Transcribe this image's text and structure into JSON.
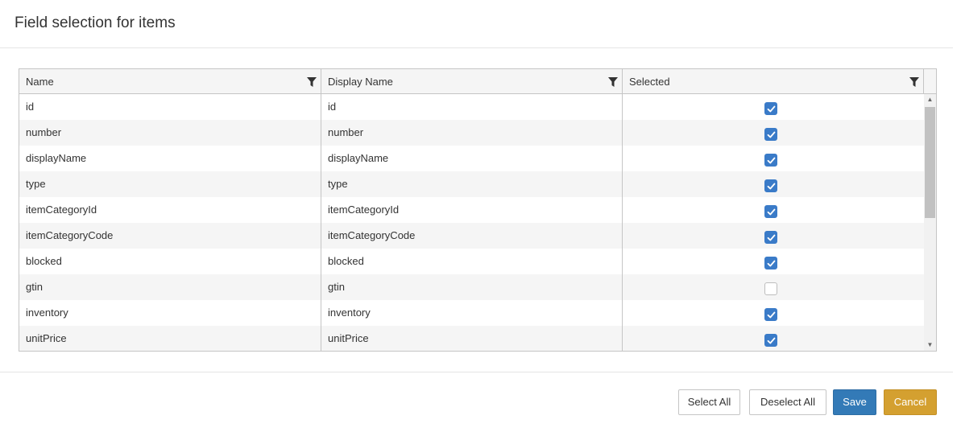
{
  "dialog": {
    "title": "Field selection for items"
  },
  "grid": {
    "columns": [
      {
        "label": "Name",
        "filter_icon": "filter-icon"
      },
      {
        "label": "Display Name",
        "filter_icon": "filter-icon"
      },
      {
        "label": "Selected",
        "filter_icon": "filter-icon"
      }
    ],
    "rows": [
      {
        "name": "id",
        "display_name": "id",
        "selected": true
      },
      {
        "name": "number",
        "display_name": "number",
        "selected": true
      },
      {
        "name": "displayName",
        "display_name": "displayName",
        "selected": true
      },
      {
        "name": "type",
        "display_name": "type",
        "selected": true
      },
      {
        "name": "itemCategoryId",
        "display_name": "itemCategoryId",
        "selected": true
      },
      {
        "name": "itemCategoryCode",
        "display_name": "itemCategoryCode",
        "selected": true
      },
      {
        "name": "blocked",
        "display_name": "blocked",
        "selected": true
      },
      {
        "name": "gtin",
        "display_name": "gtin",
        "selected": false
      },
      {
        "name": "inventory",
        "display_name": "inventory",
        "selected": true
      },
      {
        "name": "unitPrice",
        "display_name": "unitPrice",
        "selected": true
      }
    ]
  },
  "footer": {
    "select_all_label": "Select All",
    "deselect_all_label": "Deselect All",
    "save_label": "Save",
    "cancel_label": "Cancel"
  },
  "colors": {
    "accent": "#3a7bc8",
    "save": "#337ab7",
    "cancel": "#d4a030",
    "row_alt": "#f5f5f5"
  }
}
